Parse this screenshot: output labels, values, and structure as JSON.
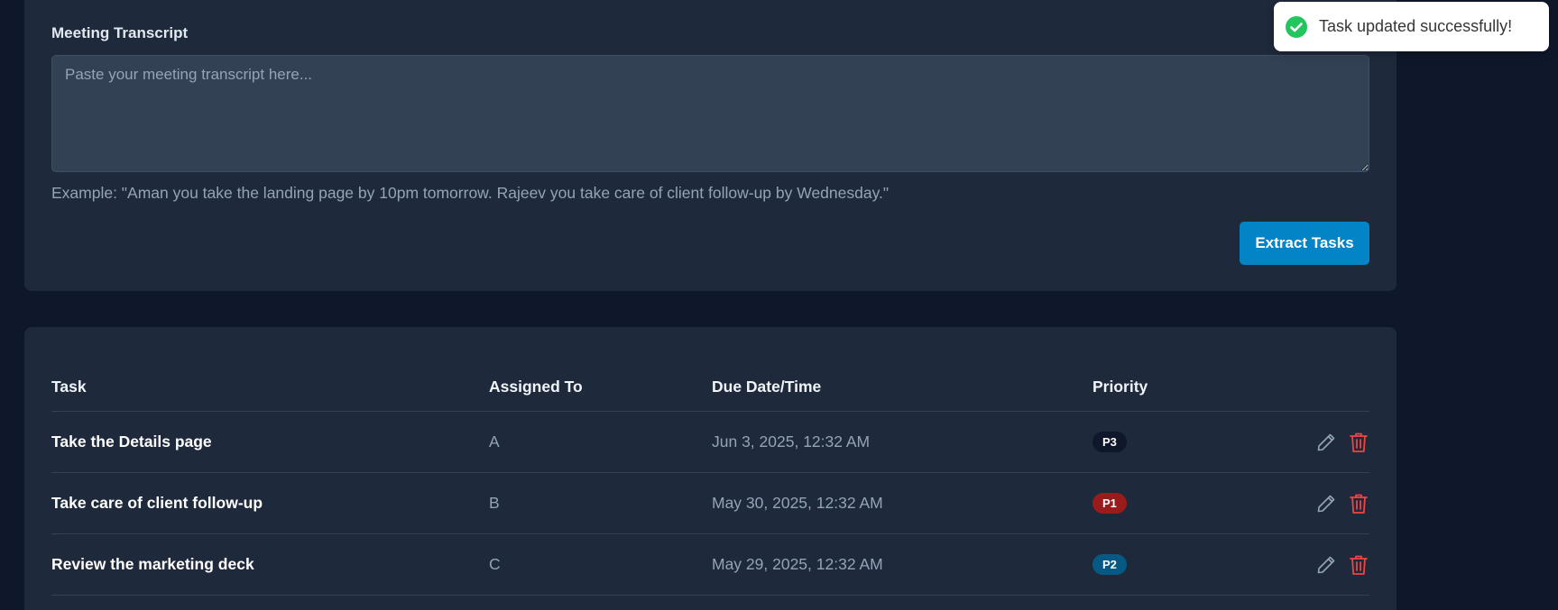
{
  "colors": {
    "page_background": "#0f172a",
    "card_background": "#1e293b",
    "input_background": "#334155",
    "accent_button": "#0284c7",
    "toast_success": "#22c55e",
    "delete_icon": "#ef4444",
    "edit_icon": "#94a3b8"
  },
  "transcript": {
    "label": "Meeting Transcript",
    "placeholder": "Paste your meeting transcript here...",
    "value": "",
    "example": "Example: \"Aman you take the landing page by 10pm tomorrow. Rajeev you take care of client follow-up by Wednesday.\"",
    "extract_button_label": "Extract Tasks"
  },
  "tasks_table": {
    "headers": {
      "task": "Task",
      "assigned_to": "Assigned To",
      "due": "Due Date/Time",
      "priority": "Priority"
    },
    "rows": [
      {
        "task": "Take the Details page",
        "assigned_to": "A",
        "due": "Jun 3, 2025, 12:32 AM",
        "priority": "P3",
        "priority_color": "#0f172a"
      },
      {
        "task": "Take care of client follow-up",
        "assigned_to": "B",
        "due": "May 30, 2025, 12:32 AM",
        "priority": "P1",
        "priority_color": "#991b1b"
      },
      {
        "task": "Review the marketing deck",
        "assigned_to": "C",
        "due": "May 29, 2025, 12:32 AM",
        "priority": "P2",
        "priority_color": "#075985"
      }
    ],
    "row_actions": {
      "edit_icon": "pencil-icon",
      "delete_icon": "trash-icon"
    }
  },
  "toast": {
    "icon": "check-circle-icon",
    "message": "Task updated successfully!"
  }
}
